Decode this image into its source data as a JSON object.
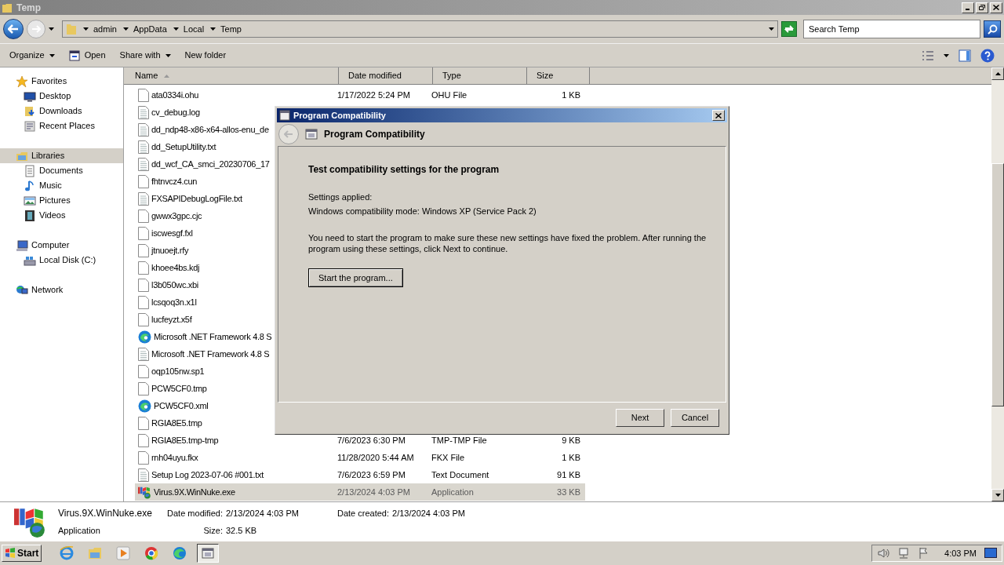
{
  "window": {
    "title": "Temp"
  },
  "navigation": {
    "breadcrumb": [
      "admin",
      "AppData",
      "Local",
      "Temp"
    ],
    "search": {
      "placeholder": "Search Temp"
    }
  },
  "toolbar": {
    "buttons": [
      {
        "label": "Organize",
        "kind": "menu"
      },
      {
        "label": "Open",
        "kind": "icon"
      },
      {
        "label": "Share with",
        "kind": "menu"
      },
      {
        "label": "New folder",
        "kind": "plain"
      }
    ]
  },
  "sidebar": {
    "groups": [
      {
        "label": "Favorites",
        "kind": "star",
        "selected": false,
        "children": [
          {
            "label": "Desktop",
            "kind": "desktop"
          },
          {
            "label": "Downloads",
            "kind": "downloads"
          },
          {
            "label": "Recent Places",
            "kind": "recent"
          }
        ]
      },
      {
        "label": "Libraries",
        "kind": "libraries",
        "selected": true,
        "children": [
          {
            "label": "Documents",
            "kind": "documents"
          },
          {
            "label": "Music",
            "kind": "music"
          },
          {
            "label": "Pictures",
            "kind": "pictures"
          },
          {
            "label": "Videos",
            "kind": "videos"
          }
        ]
      },
      {
        "label": "Computer",
        "kind": "computer",
        "selected": false,
        "children": [
          {
            "label": "Local Disk (C:)",
            "kind": "disk"
          }
        ]
      },
      {
        "label": "Network",
        "kind": "network",
        "selected": false
      }
    ]
  },
  "file_list": {
    "columns": [
      {
        "label": "Name",
        "sorted": true
      },
      {
        "label": "Date modified",
        "sorted": false
      },
      {
        "label": "Type",
        "sorted": false
      },
      {
        "label": "Size",
        "sorted": false
      }
    ],
    "rows": [
      {
        "name": "ata0334i.ohu",
        "kind": "blank",
        "date": "1/17/2022 5:24 PM",
        "type": "OHU File",
        "size": "1 KB",
        "selected": false
      },
      {
        "name": "cv_debug.log",
        "kind": "text",
        "selected": false
      },
      {
        "name": "dd_ndp48-x86-x64-allos-enu_de",
        "kind": "text",
        "selected": false
      },
      {
        "name": "dd_SetupUtility.txt",
        "kind": "text",
        "selected": false
      },
      {
        "name": "dd_wcf_CA_smci_20230706_17",
        "kind": "text",
        "selected": false
      },
      {
        "name": "fhtnvcz4.cun",
        "kind": "blank",
        "selected": false
      },
      {
        "name": "FXSAPIDebugLogFile.txt",
        "kind": "text",
        "selected": false
      },
      {
        "name": "gwwx3gpc.cjc",
        "kind": "blank",
        "selected": false
      },
      {
        "name": "iscwesgf.fxl",
        "kind": "blank",
        "selected": false
      },
      {
        "name": "jtnuoejt.rfy",
        "kind": "blank",
        "selected": false
      },
      {
        "name": "khoee4bs.kdj",
        "kind": "blank",
        "selected": false
      },
      {
        "name": "l3b050wc.xbi",
        "kind": "blank",
        "selected": false
      },
      {
        "name": "lcsqoq3n.x1l",
        "kind": "blank",
        "selected": false
      },
      {
        "name": "lucfeyzt.x5f",
        "kind": "blank",
        "selected": false
      },
      {
        "name": "Microsoft .NET Framework 4.8 S",
        "kind": "edge",
        "selected": false
      },
      {
        "name": "Microsoft .NET Framework 4.8 S",
        "kind": "text",
        "selected": false
      },
      {
        "name": "oqp105nw.sp1",
        "kind": "blank",
        "selected": false
      },
      {
        "name": "PCW5CF0.tmp",
        "kind": "blank",
        "selected": false
      },
      {
        "name": "PCW5CF0.xml",
        "kind": "edge",
        "selected": false
      },
      {
        "name": "RGIA8E5.tmp",
        "kind": "blank",
        "selected": false
      },
      {
        "name": "RGIA8E5.tmp-tmp",
        "kind": "blank",
        "date": "7/6/2023 6:30 PM",
        "type": "TMP-TMP File",
        "size": "9 KB",
        "selected": false
      },
      {
        "name": "rnh04uyu.fkx",
        "kind": "blank",
        "date": "11/28/2020 5:44 AM",
        "type": "FKX File",
        "size": "1 KB",
        "selected": false
      },
      {
        "name": "Setup Log 2023-07-06 #001.txt",
        "kind": "text",
        "date": "7/6/2023 6:59 PM",
        "type": "Text Document",
        "size": "91 KB",
        "selected": false
      },
      {
        "name": "Virus.9X.WinNuke.exe",
        "kind": "exe",
        "date": "2/13/2024 4:03 PM",
        "type": "Application",
        "size": "33 KB",
        "selected": true
      }
    ]
  },
  "details": {
    "name": "Virus.9X.WinNuke.exe",
    "type": "Application",
    "fields": [
      {
        "label": "Date modified:",
        "value": "2/13/2024 4:03 PM"
      },
      {
        "label": "Size:",
        "value": "32.5 KB"
      },
      {
        "label": "Date created:",
        "value": "2/13/2024 4:03 PM"
      }
    ]
  },
  "dialog": {
    "title": "Program Compatibility",
    "header": "Program Compatibility",
    "back_disabled": true,
    "heading": "Test compatibility settings for the program",
    "settings_label": "Settings applied:",
    "settings_value": "Windows compatibility mode: Windows XP (Service Pack 2)",
    "message": "You need to start the program to make sure these new settings have fixed the problem. After running the program using these settings, click Next to continue.",
    "action": "Start the program...",
    "buttons": [
      "Next",
      "Cancel"
    ]
  },
  "taskbar": {
    "start": "Start",
    "apps": [
      {
        "kind": "ie",
        "selected": false
      },
      {
        "kind": "explorer",
        "selected": false
      },
      {
        "kind": "media",
        "selected": false
      },
      {
        "kind": "chrome",
        "selected": false
      },
      {
        "kind": "edge",
        "selected": false
      },
      {
        "kind": "compat",
        "selected": true
      }
    ],
    "clock": "4:03 PM"
  }
}
